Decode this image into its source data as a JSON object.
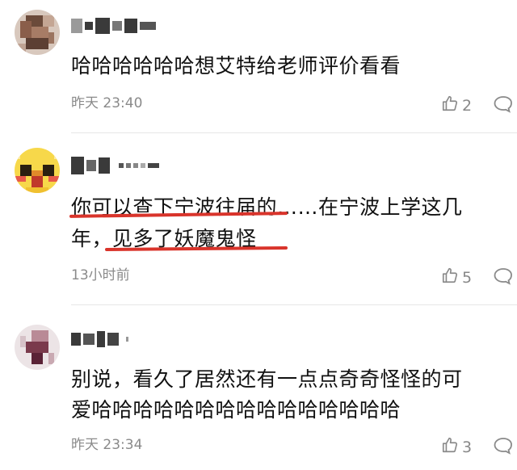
{
  "comments": [
    {
      "text": "哈哈哈哈哈哈想艾特给老师评价看看",
      "time": "昨天 23:40",
      "likes": "2",
      "username_pixelated": true
    },
    {
      "text_line1": "你可以查下宁波往届的……在宁波上学这几",
      "text_line2": "年，见多了妖魔鬼怪",
      "time": "13小时前",
      "likes": "5",
      "username_pixelated": true,
      "annotation_color": "#d9342b"
    },
    {
      "text_line1": "别说，看久了居然还有一点点奇奇怪怪的可",
      "text_line2": "爱哈哈哈哈哈哈哈哈哈哈哈哈哈哈哈",
      "time": "昨天 23:34",
      "likes": "3",
      "username_pixelated": true
    }
  ],
  "icons": {
    "like": "thumbs-up-icon",
    "reply": "comment-bubble-icon"
  }
}
